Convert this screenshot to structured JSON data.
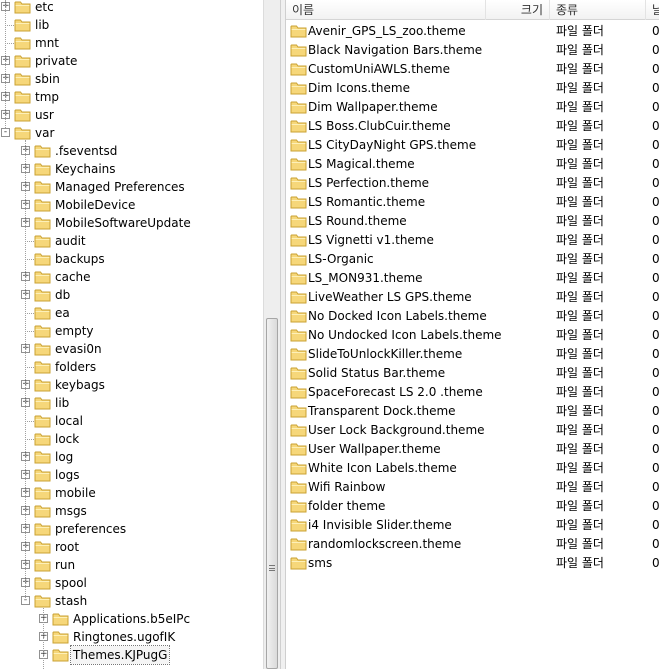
{
  "tree": {
    "items": [
      {
        "label": "etc",
        "level": 0,
        "expander": "+"
      },
      {
        "label": "lib",
        "level": 0,
        "expander": ""
      },
      {
        "label": "mnt",
        "level": 0,
        "expander": ""
      },
      {
        "label": "private",
        "level": 0,
        "expander": "+"
      },
      {
        "label": "sbin",
        "level": 0,
        "expander": "+"
      },
      {
        "label": "tmp",
        "level": 0,
        "expander": "+"
      },
      {
        "label": "usr",
        "level": 0,
        "expander": "+"
      },
      {
        "label": "var",
        "level": 0,
        "expander": "-"
      },
      {
        "label": ".fseventsd",
        "level": 1,
        "expander": "+"
      },
      {
        "label": "Keychains",
        "level": 1,
        "expander": "+"
      },
      {
        "label": "Managed Preferences",
        "level": 1,
        "expander": "+"
      },
      {
        "label": "MobileDevice",
        "level": 1,
        "expander": "+"
      },
      {
        "label": "MobileSoftwareUpdate",
        "level": 1,
        "expander": "+"
      },
      {
        "label": "audit",
        "level": 1,
        "expander": ""
      },
      {
        "label": "backups",
        "level": 1,
        "expander": ""
      },
      {
        "label": "cache",
        "level": 1,
        "expander": "+"
      },
      {
        "label": "db",
        "level": 1,
        "expander": "+"
      },
      {
        "label": "ea",
        "level": 1,
        "expander": ""
      },
      {
        "label": "empty",
        "level": 1,
        "expander": ""
      },
      {
        "label": "evasi0n",
        "level": 1,
        "expander": "+"
      },
      {
        "label": "folders",
        "level": 1,
        "expander": ""
      },
      {
        "label": "keybags",
        "level": 1,
        "expander": "+"
      },
      {
        "label": "lib",
        "level": 1,
        "expander": "+"
      },
      {
        "label": "local",
        "level": 1,
        "expander": ""
      },
      {
        "label": "lock",
        "level": 1,
        "expander": ""
      },
      {
        "label": "log",
        "level": 1,
        "expander": "+"
      },
      {
        "label": "logs",
        "level": 1,
        "expander": "+"
      },
      {
        "label": "mobile",
        "level": 1,
        "expander": "+"
      },
      {
        "label": "msgs",
        "level": 1,
        "expander": "+"
      },
      {
        "label": "preferences",
        "level": 1,
        "expander": "+"
      },
      {
        "label": "root",
        "level": 1,
        "expander": "+"
      },
      {
        "label": "run",
        "level": 1,
        "expander": "+"
      },
      {
        "label": "spool",
        "level": 1,
        "expander": "+"
      },
      {
        "label": "stash",
        "level": 1,
        "expander": "-"
      },
      {
        "label": "Applications.b5eIPc",
        "level": 2,
        "expander": "+"
      },
      {
        "label": "Ringtones.ugofIK",
        "level": 2,
        "expander": "+"
      },
      {
        "label": "Themes.KJPugG",
        "level": 2,
        "expander": "+",
        "selected": true
      }
    ]
  },
  "list": {
    "columns": {
      "name": "이름",
      "size": "크기",
      "type": "종류",
      "extra": "날"
    },
    "folder_type": "파일 폴더",
    "extra_value": "0",
    "rows": [
      "Avenir_GPS_LS_zoo.theme",
      "Black Navigation Bars.theme",
      "CustomUniAWLS.theme",
      "Dim Icons.theme",
      "Dim Wallpaper.theme",
      "LS Boss.ClubCuir.theme",
      "LS CityDayNight GPS.theme",
      "LS Magical.theme",
      "LS Perfection.theme",
      "LS Romantic.theme",
      "LS Round.theme",
      "LS Vignetti v1.theme",
      "LS-Organic",
      "LS_MON931.theme",
      "LiveWeather LS GPS.theme",
      "No Docked Icon Labels.theme",
      "No Undocked Icon Labels.theme",
      "SlideToUnlockKiller.theme",
      "Solid Status Bar.theme",
      "SpaceForecast LS 2.0 .theme",
      "Transparent Dock.theme",
      "User Lock Background.theme",
      "User Wallpaper.theme",
      "White Icon Labels.theme",
      "Wifi Rainbow",
      "folder theme",
      "i4 Invisible Slider.theme",
      "randomlockscreen.theme",
      "sms"
    ]
  },
  "colors": {
    "folder_fill": "#f6d77a",
    "folder_edge": "#c9a233",
    "folder_light": "#fdf0b8"
  },
  "icons": {
    "folder": "folder-icon",
    "expander": "expand-toggle-icon"
  }
}
